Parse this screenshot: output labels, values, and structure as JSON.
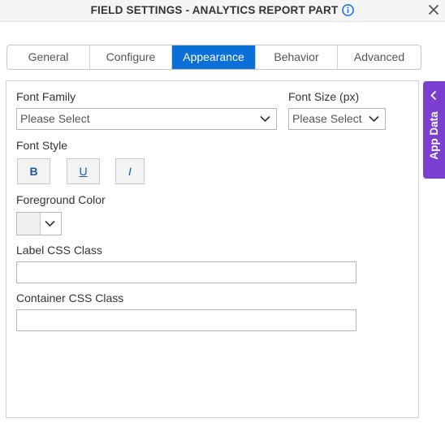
{
  "header": {
    "title": "FIELD SETTINGS - ANALYTICS REPORT PART",
    "info_icon": "info-icon",
    "close_icon": "close-icon"
  },
  "tabs": [
    {
      "label": "General",
      "active": false
    },
    {
      "label": "Configure",
      "active": false
    },
    {
      "label": "Appearance",
      "active": true
    },
    {
      "label": "Behavior",
      "active": false
    },
    {
      "label": "Advanced",
      "active": false
    }
  ],
  "appearance": {
    "font_family": {
      "label": "Font Family",
      "value": "Please Select"
    },
    "font_size": {
      "label": "Font Size (px)",
      "value": "Please Select"
    },
    "font_style": {
      "label": "Font Style",
      "bold": "B",
      "underline": "U",
      "italic": "I"
    },
    "foreground_color": {
      "label": "Foreground Color",
      "value": "#f0f0f0"
    },
    "label_css_class": {
      "label": "Label CSS Class",
      "value": ""
    },
    "container_css_class": {
      "label": "Container CSS Class",
      "value": ""
    }
  },
  "side_panel": {
    "label": "App Data",
    "icon": "chevron-left-icon"
  },
  "colors": {
    "accent": "#0a6fd6",
    "side_panel": "#7a3fd1",
    "style_button_text": "#1a5aa0"
  }
}
